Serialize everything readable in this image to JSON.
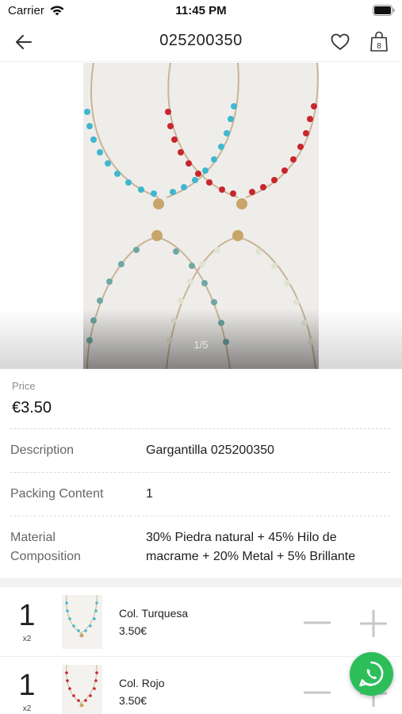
{
  "status_bar": {
    "carrier": "Carrier",
    "time": "11:45 PM"
  },
  "nav": {
    "title": "025200350",
    "cart_count": "8"
  },
  "gallery": {
    "counter": "1/5"
  },
  "price": {
    "label": "Price",
    "value": "€3.50"
  },
  "specs": [
    {
      "label": "Description",
      "value": "Gargantilla 025200350"
    },
    {
      "label": "Packing Content",
      "value": "1"
    },
    {
      "label": "Material Composition",
      "value": "30% Piedra natural + 45% Hilo de macrame + 20% Metal + 5% Brillante"
    }
  ],
  "variants": [
    {
      "qty": "1",
      "multiplier": "x2",
      "name": "Col. Turquesa",
      "price": "3.50€",
      "color": "#46b9cf"
    },
    {
      "qty": "1",
      "multiplier": "x2",
      "name": "Col. Rojo",
      "price": "3.50€",
      "color": "#c8262c"
    }
  ],
  "colors": {
    "accent_whatsapp": "#2dbe5a",
    "control_gray": "#c7c7c7"
  }
}
